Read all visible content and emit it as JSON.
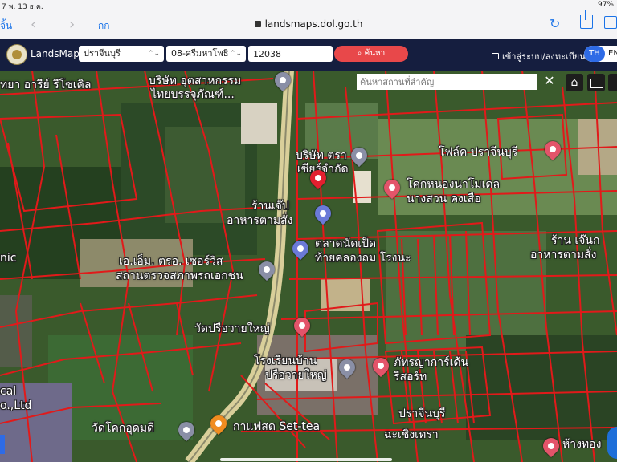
{
  "status_bar": {
    "left": "7  พ. 13 ธ.ค.",
    "right": "97%"
  },
  "browser": {
    "done_label": "จิ้น",
    "back_glyph": "‹",
    "forward_glyph": "›",
    "text_size_label": "กก",
    "url": "landsmaps.dol.go.th",
    "reload_glyph": "↻"
  },
  "header": {
    "app_name": "LandsMaps",
    "province": "ปราจีนบุรี",
    "district": "08-ศรีมหาโพธิ",
    "parcel_number": "12038",
    "search_button": "ค้นหา",
    "login": "เข้าสู่ระบบ/ลงทะเบียน",
    "lang_th": "TH",
    "lang_en": "EN",
    "select_chevron": "⌃⌄"
  },
  "map": {
    "place_search_placeholder": "ค้นหาสถานที่สำคัญ",
    "clear_glyph": "✕",
    "home_glyph": "⌂",
    "labels": [
      "ทยา อารีย์ รีโซเคิล",
      "บริษัท อุตสาหกรรม",
      "ไทยบรรจุภัณฑ์...",
      "บริษัท ตรา",
      "เซียร์จำกัด",
      "โฟล์ค ปราจีนบุรี",
      "โคกหนองนาโมเดล",
      "นางสวน คงเสือ",
      "ร้านเจ๊ป",
      "อาหารตามสั่ง",
      "ร้าน เจ๊นก",
      "อาหารตามสั่ง",
      "ตลาดนัดเป็ด",
      "ท้ายคลองถม โรงนะ",
      "เอ.เอ็ม. ตรอ. เซอร์วิส",
      "สถานตรวจสภาพรถเอกชน",
      "nic",
      "วัดปรือวายใหญ่",
      "โรงเรียนบ้าน",
      "ปรือวายใหญ่",
      "ภัทรญาการ์เด้น",
      "รีสอร์ท",
      "cal",
      "o.,Ltd",
      "วัดโคกอุดมดี",
      "กาแฟสด Set-tea",
      "ปราจีนบุรี",
      "ฉะเชิงเทรา",
      "ห้างทอง"
    ]
  },
  "colors": {
    "header_bg": "#151e3f",
    "search_button": "#e8484a",
    "lang_active": "#2e6be6",
    "parcel_lines": "#e11a1a",
    "accent_link": "#1a73e8"
  }
}
